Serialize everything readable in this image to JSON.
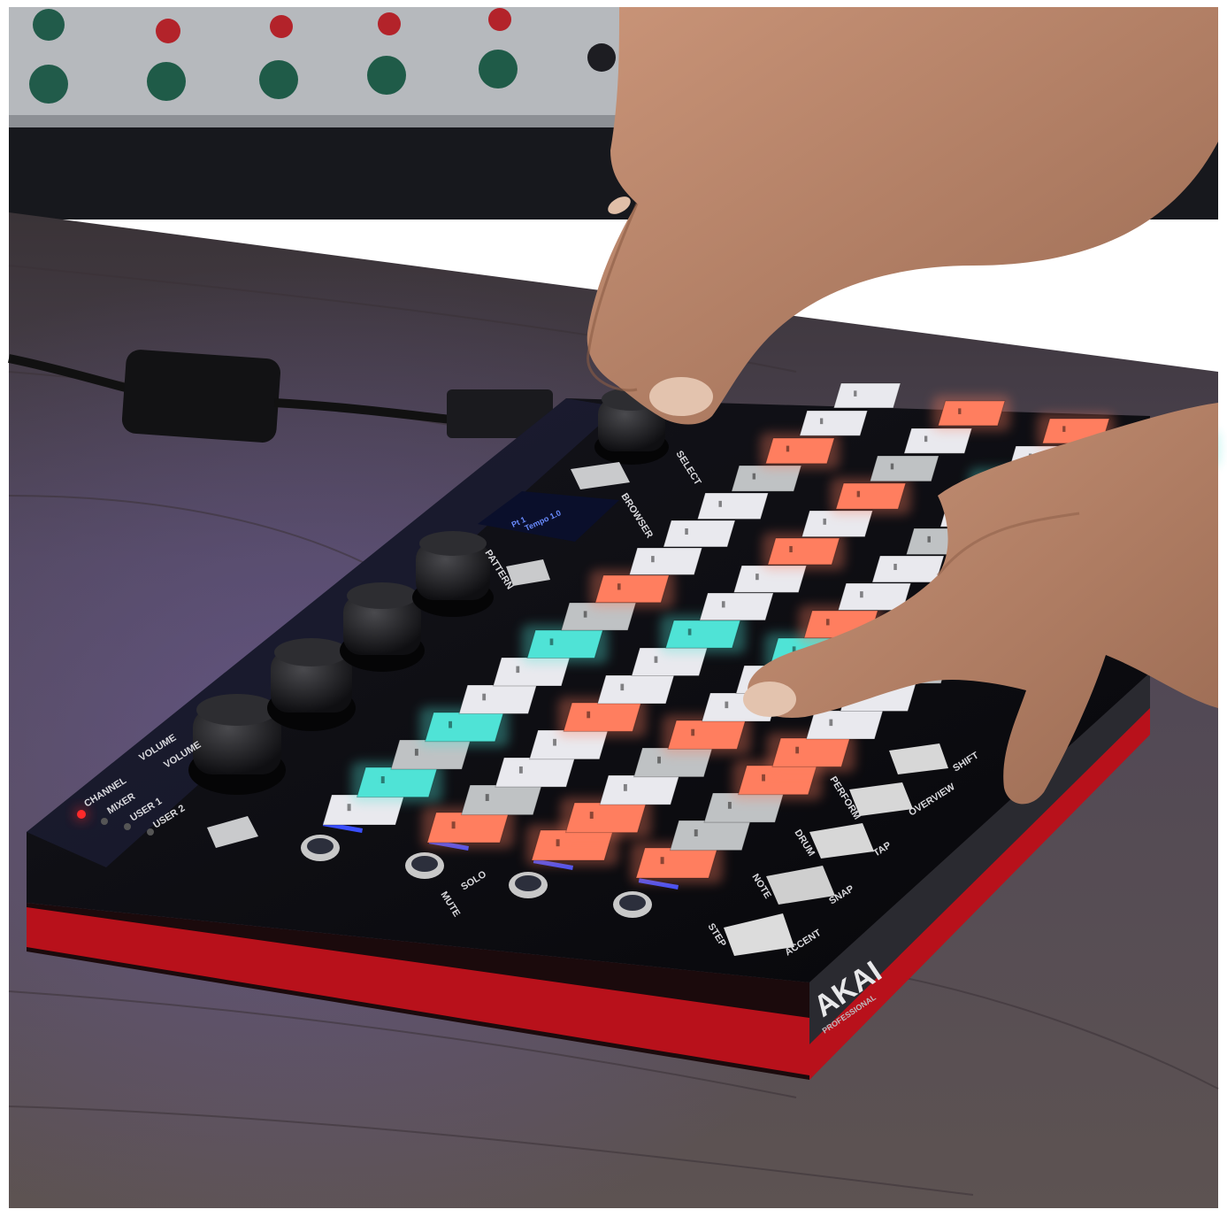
{
  "photo": {
    "subject": "hands-on-pad-controller",
    "colors": {
      "frame": "#ffffff",
      "desk": "#4a3f4a",
      "desk_glow": "#5a4a78",
      "rack": "#b9bcc0",
      "body": "#0d0d12",
      "body_edge": "#b8111b",
      "pad_orange": "#ff7e5f",
      "pad_white": "#e9e9ee",
      "pad_gray": "#bfc2c4",
      "pad_cyan": "#4fe3d6",
      "skin": "#b98569"
    }
  },
  "device": {
    "brand": "AKAI",
    "brand_sub": "PROFESSIONAL",
    "labels": {
      "channel": "CHANNEL",
      "mixer": "MIXER",
      "user1": "USER 1",
      "user2": "USER 2",
      "volume1": "VOLUME",
      "volume2": "VOLUME",
      "browser": "BROWSER",
      "select": "SELECT",
      "pattern": "PATTERN",
      "mute": "MUTE",
      "solo": "SOLO",
      "step": "STEP",
      "accent": "ACCENT",
      "note": "NOTE",
      "snap": "SNAP",
      "drum": "DRUM",
      "tap": "TAP",
      "perform": "PERFORM",
      "overview": "OVERVIEW",
      "shift": "SHIFT"
    },
    "display": {
      "line1": "Pt 1",
      "line2": "Tempo 1.0"
    }
  }
}
